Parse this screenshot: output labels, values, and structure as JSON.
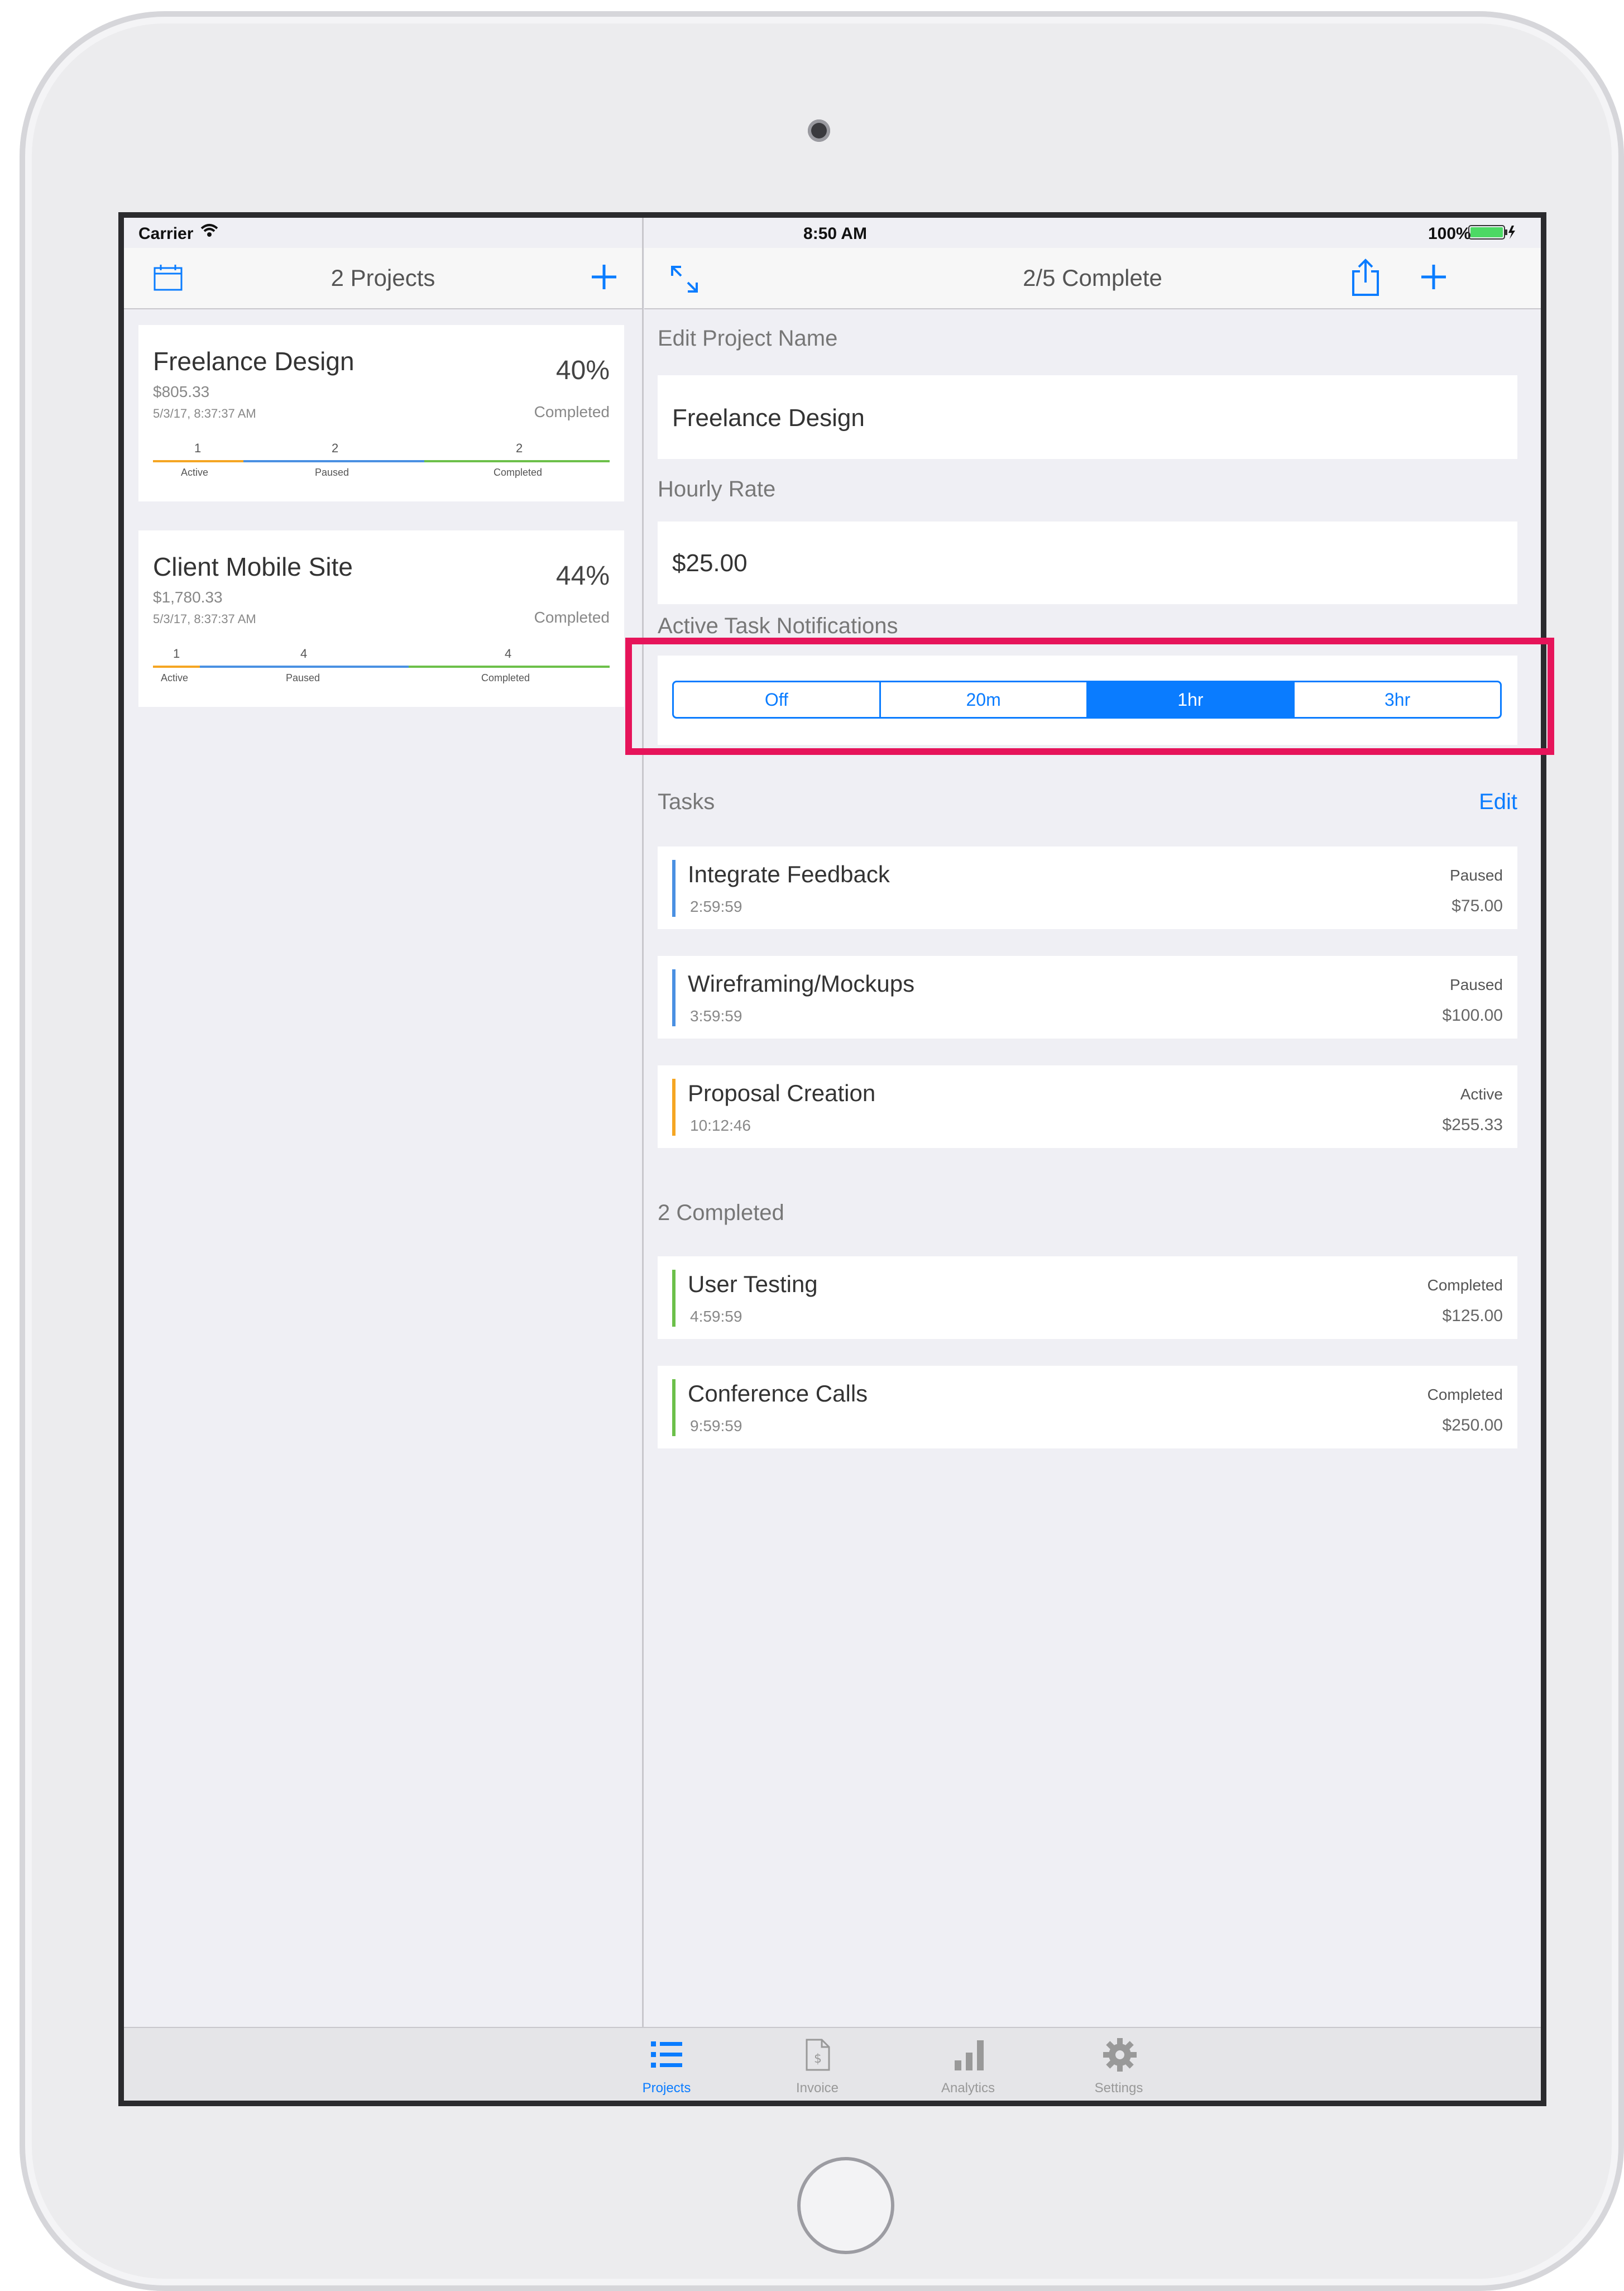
{
  "statusbar": {
    "carrier": "Carrier",
    "time": "8:50 AM",
    "battery": "100%"
  },
  "left_nav": {
    "title": "2 Projects"
  },
  "right_nav": {
    "title": "2/5 Complete"
  },
  "projects": [
    {
      "name": "Freelance Design",
      "amount": "$805.33",
      "date": "5/3/17, 8:37:37 AM",
      "percent": "40%",
      "percent_label": "Completed",
      "counts": {
        "active": "1",
        "paused": "2",
        "completed": "2"
      },
      "labels": {
        "active": "Active",
        "paused": "Paused",
        "completed": "Completed"
      }
    },
    {
      "name": "Client Mobile Site",
      "amount": "$1,780.33",
      "date": "5/3/17, 8:37:37 AM",
      "percent": "44%",
      "percent_label": "Completed",
      "counts": {
        "active": "1",
        "paused": "4",
        "completed": "4"
      },
      "labels": {
        "active": "Active",
        "paused": "Paused",
        "completed": "Completed"
      }
    }
  ],
  "edit": {
    "project_name_label": "Edit Project Name",
    "project_name_value": "Freelance Design",
    "hourly_rate_label": "Hourly Rate",
    "hourly_rate_value": "$25.00",
    "notifications_label": "Active Task Notifications",
    "notification_options": [
      "Off",
      "20m",
      "1hr",
      "3hr"
    ],
    "notification_selected": "1hr"
  },
  "tasks_section": {
    "label": "Tasks",
    "edit": "Edit"
  },
  "tasks": [
    {
      "name": "Integrate Feedback",
      "time": "2:59:59",
      "status": "Paused",
      "amount": "$75.00",
      "color": "#4a90e2"
    },
    {
      "name": "Wireframing/Mockups",
      "time": "3:59:59",
      "status": "Paused",
      "amount": "$100.00",
      "color": "#4a90e2"
    },
    {
      "name": "Proposal Creation",
      "time": "10:12:46",
      "status": "Active",
      "amount": "$255.33",
      "color": "#f5a623"
    }
  ],
  "completed_section": {
    "label": "2 Completed"
  },
  "completed_tasks": [
    {
      "name": "User Testing",
      "time": "4:59:59",
      "status": "Completed",
      "amount": "$125.00",
      "color": "#6cc04a"
    },
    {
      "name": "Conference Calls",
      "time": "9:59:59",
      "status": "Completed",
      "amount": "$250.00",
      "color": "#6cc04a"
    }
  ],
  "tabbar": [
    {
      "label": "Projects",
      "icon": "list-icon",
      "selected": true
    },
    {
      "label": "Invoice",
      "icon": "invoice-icon",
      "selected": false
    },
    {
      "label": "Analytics",
      "icon": "bar-chart-icon",
      "selected": false
    },
    {
      "label": "Settings",
      "icon": "gear-icon",
      "selected": false
    }
  ],
  "colors": {
    "accent": "#0a7cff",
    "active": "#f5a623",
    "paused": "#4a90e2",
    "completed": "#6cc04a",
    "highlight": "#e6145a"
  }
}
